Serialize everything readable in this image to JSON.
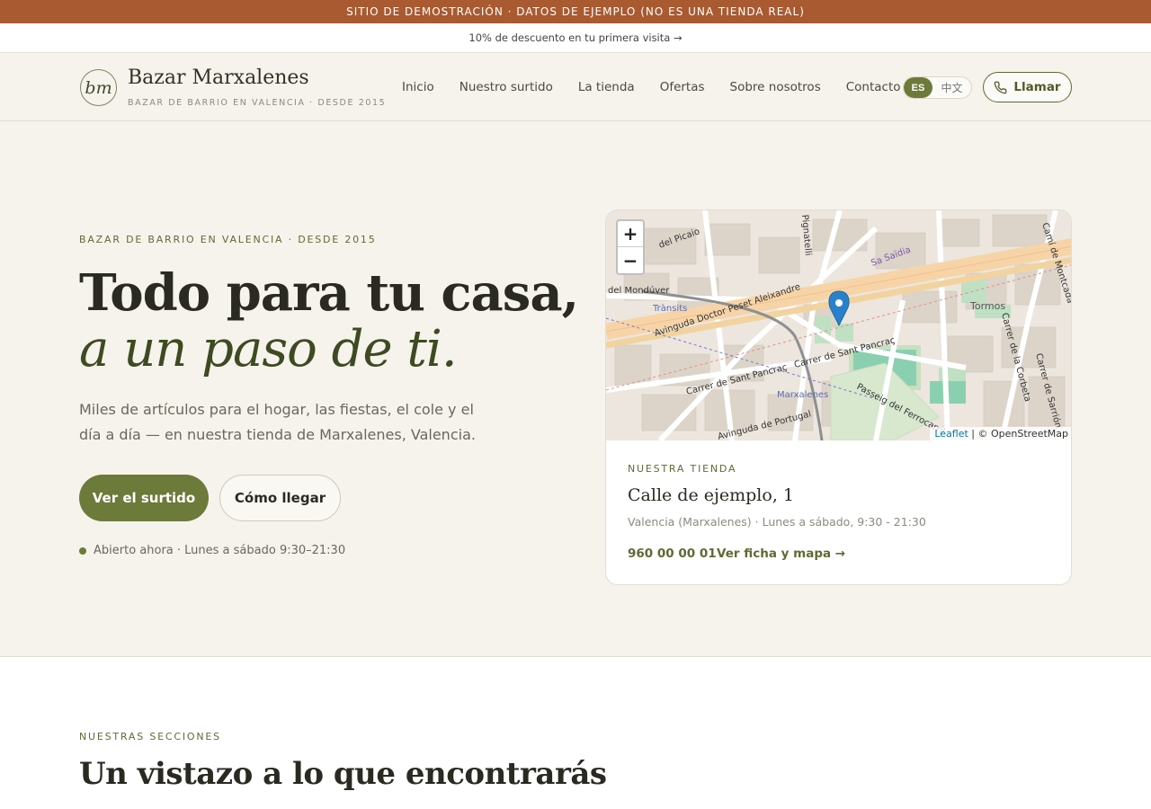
{
  "demo_bar": "SITIO DE DEMOSTRACIÓN · DATOS DE EJEMPLO (NO ES UNA TIENDA REAL)",
  "promo_bar": "10% de descuento en tu primera visita →",
  "header": {
    "logo": "bm",
    "brand": "Bazar Marxalenes",
    "tagline": "BAZAR DE BARRIO EN VALENCIA · DESDE 2015",
    "nav": [
      "Inicio",
      "Nuestro surtido",
      "La tienda",
      "Ofertas",
      "Sobre nosotros",
      "Contacto"
    ],
    "lang_active": "ES",
    "lang_other": "中文",
    "call_label": "Llamar"
  },
  "hero": {
    "eyebrow": "BAZAR DE BARRIO EN VALENCIA · DESDE 2015",
    "title_line1": "Todo para tu casa,",
    "title_line2": "a un paso de ti.",
    "lede": "Miles de artículos para el hogar, las fiestas, el cole y el día a día — en nuestra tienda de Marxalenes, Valencia.",
    "primary_cta": "Ver el surtido",
    "secondary_cta": "Cómo llegar",
    "status": "Abierto ahora · Lunes a sábado 9:30–21:30"
  },
  "store_card": {
    "map": {
      "zoom_in": "+",
      "zoom_out": "−",
      "attribution_leaflet": "Leaflet",
      "attribution_rest": " | © OpenStreetMap",
      "labels": [
        "Avinguda Doctor Peset Aleixandre",
        "Carrer de Sant Pancraç",
        "Marxalenes",
        "Trànsits",
        "Tormos",
        "Passeig del Ferrocarril",
        "Avinguda de Portugal",
        "Sa Saïdia",
        "del Picaio",
        "del Mondúver",
        "Camí de Montcada",
        "Carrer de la Corbeta",
        "Carrer de Sarrión",
        "Pignatelli"
      ]
    },
    "eyebrow": "NUESTRA TIENDA",
    "address": "Calle de ejemplo, 1",
    "hours": "Valencia (Marxalenes) · Lunes a sábado, 9:30 - 21:30",
    "phone": "960 00 00 01",
    "map_link": "Ver ficha y mapa →"
  },
  "sections": {
    "eyebrow": "NUESTRAS SECCIONES",
    "title": "Un vistazo a lo que encontrarás"
  },
  "colors": {
    "accent": "#6c7a3a",
    "demo_bar": "#a95a30",
    "background": "#f6f3ec"
  }
}
